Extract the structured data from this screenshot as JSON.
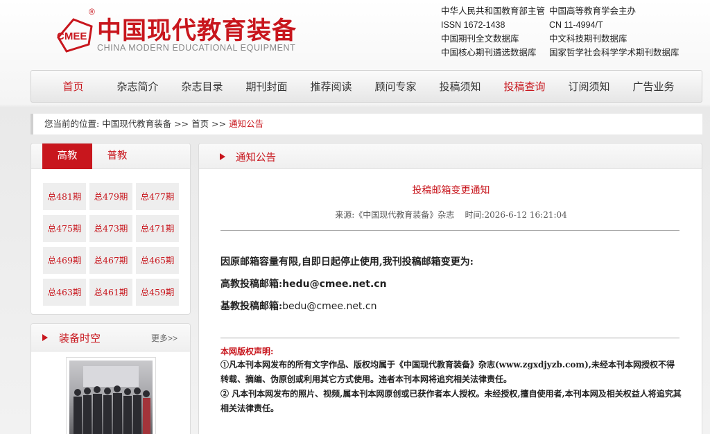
{
  "logo": {
    "cn": "中国现代教育装备",
    "en": "CHINA MODERN  EDUCATIONAL  EQUIPMENT",
    "mark": "CMEE",
    "reg": "®"
  },
  "pubinfo": [
    [
      "中华人民共和国教育部主管",
      "中国高等教育学会主办"
    ],
    [
      "ISSN 1672-1438",
      "CN 11-4994/T"
    ],
    [
      "中国期刊全文数据库",
      "中文科技期刊数据库"
    ],
    [
      "中国核心期刊遴选数据库",
      "国家哲学社会科学学术期刊数据库"
    ]
  ],
  "nav": [
    "首页",
    "杂志简介",
    "杂志目录",
    "期刊封面",
    "推荐阅读",
    "顾问专家",
    "投稿须知",
    "投稿查询",
    "订阅须知",
    "广告业务"
  ],
  "breadcrumb": {
    "prefix": "您当前的位置:",
    "home": "中国现代教育装备",
    "sep1": ">>",
    "index": "首页",
    "sep2": ">>",
    "current": "通知公告"
  },
  "issues_panel": {
    "tabs": [
      "高教",
      "普教"
    ],
    "items": [
      "总481期",
      "总479期",
      "总477期",
      "总475期",
      "总473期",
      "总471期",
      "总469期",
      "总467期",
      "总465期",
      "总463期",
      "总461期",
      "总459期"
    ]
  },
  "gallery": {
    "title": "装备时空",
    "more": "更多>>"
  },
  "main": {
    "section_title": "通知公告",
    "article_title": "投稿邮箱变更通知",
    "meta": "来源:《中国现代教育装备》杂志    时间:2026-6-12 16:21:04",
    "intro": "因原邮箱容量有限,自即日起停止使用,我刊投稿邮箱变更为:",
    "he_label": "高教投稿邮箱:",
    "he_email": "hedu@cmee.net.cn",
    "be_label": "基教投稿邮箱:",
    "be_email": "bedu@cmee.net.cn",
    "copyright_title": "本网版权声明:",
    "copyright_1": "①凡本刊本网发布的所有文字作品、版权均属于《中国现代教育装备》杂志(www.zgxdjyzb.com),未经本刊本网授权不得转载、摘编、伪原创或利用其它方式使用。违者本刊本网将追究相关法律责任。",
    "copyright_2": "② 凡本刊本网发布的照片、视频,属本刊本网原创或已获作者本人授权。未经授权,擅自使用者,本刊本网及相关权益人将追究其相关法律责任。"
  },
  "colors": {
    "accent": "#c8161d"
  }
}
